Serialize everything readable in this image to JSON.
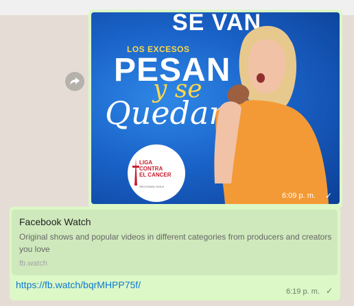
{
  "forward": {
    "icon": "forward-icon"
  },
  "media_message": {
    "image_text": {
      "headline_top": "SE VAN",
      "sub_headline": "LOS EXCESOS",
      "headline_main": "PESAN",
      "script_top": "y se",
      "script_main": "Quedan"
    },
    "logo": {
      "name": "LIGA\nCONTRA\nEL CANCER",
      "subtitle": "SECCIONAL HUILA"
    },
    "time": "6:09 p. m.",
    "status_icon": "check-icon"
  },
  "link_message": {
    "preview": {
      "title": "Facebook Watch",
      "description": "Original shows and popular videos in different categories from producers and creators you love",
      "domain": "fb.watch"
    },
    "link": "https://fb.watch/bqrMHPP75f/",
    "time": "6:19 p. m.",
    "status_icon": "check-icon"
  }
}
